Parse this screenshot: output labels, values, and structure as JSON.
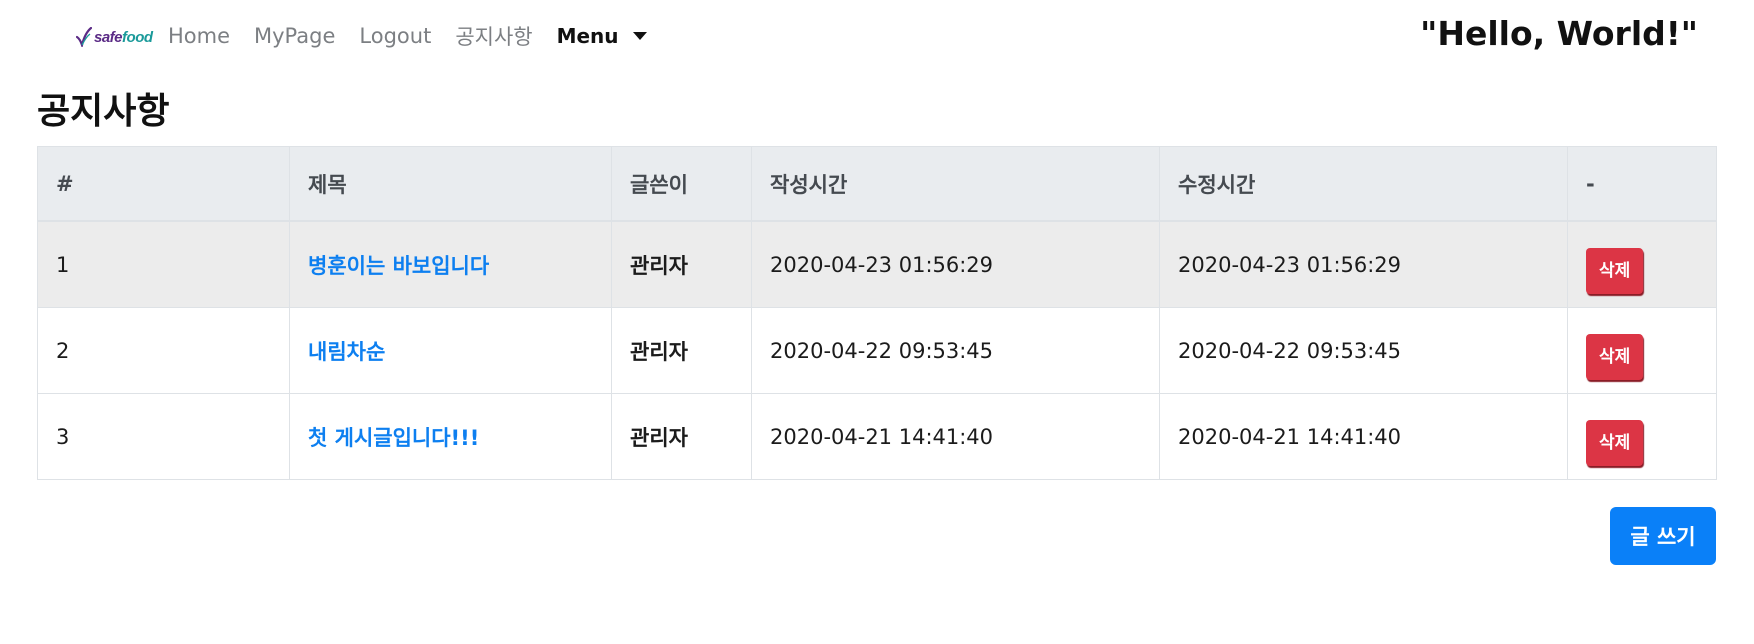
{
  "brand": {
    "logo_part1": "safe",
    "logo_part2": "food",
    "accent_purple": "#5b2b86",
    "accent_teal": "#1a9a9a"
  },
  "nav": {
    "links": [
      "Home",
      "MyPage",
      "Logout",
      "공지사항"
    ],
    "dropdown_label": "Menu"
  },
  "greeting": "\"Hello, World!\"",
  "page_title": "공지사항",
  "table": {
    "headers": [
      "#",
      "제목",
      "글쓴이",
      "작성시간",
      "수정시간",
      "-"
    ],
    "rows": [
      {
        "num": "1",
        "title": "병훈이는 바보입니다",
        "author": "관리자",
        "created": "2020-04-23 01:56:29",
        "modified": "2020-04-23 01:56:29",
        "action": "삭제"
      },
      {
        "num": "2",
        "title": "내림차순",
        "author": "관리자",
        "created": "2020-04-22 09:53:45",
        "modified": "2020-04-22 09:53:45",
        "action": "삭제"
      },
      {
        "num": "3",
        "title": "첫 게시글입니다!!!",
        "author": "관리자",
        "created": "2020-04-21 14:41:40",
        "modified": "2020-04-21 14:41:40",
        "action": "삭제"
      }
    ]
  },
  "write_button": "글 쓰기",
  "colors": {
    "link": "#0d7ff0",
    "danger": "#dc3545",
    "primary": "#0a80f8",
    "header_bg": "#e9ecef"
  }
}
